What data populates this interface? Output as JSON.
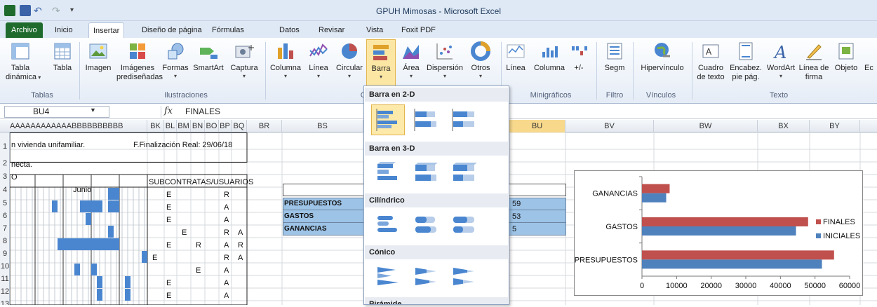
{
  "window": {
    "title": "GPUH Mimosas  -  Microsoft Excel"
  },
  "tabs": [
    "Archivo",
    "Inicio",
    "Insertar",
    "Diseño de página",
    "Fórmulas",
    "Datos",
    "Revisar",
    "Vista",
    "Foxit PDF"
  ],
  "ribbon": {
    "tabla_dinamica": [
      "Tabla",
      "dinámica"
    ],
    "tabla": "Tabla",
    "imagen": "Imagen",
    "imagenes_predis": [
      "Imágenes",
      "prediseñadas"
    ],
    "formas": "Formas",
    "smartart": "SmartArt",
    "captura": "Captura",
    "columna": "Columna",
    "linea": "Línea",
    "circular": "Circular",
    "barra": "Barra",
    "area": "Área",
    "dispersion": "Dispersión",
    "otros": "Otros",
    "mini_linea": "Línea",
    "mini_columna": "Columna",
    "mini_pm": "+/-",
    "segm": "Segm",
    "hipervinculo": "Hipervínculo",
    "cuadro_texto": [
      "Cuadro",
      "de texto"
    ],
    "encabez": [
      "Encabez.",
      "pie pág."
    ],
    "wordart": "WordArt",
    "linea_firma": [
      "Línea de",
      "firma"
    ],
    "objeto": "Objeto",
    "ec": "Ec",
    "groups": {
      "tablas": "Tablas",
      "ilustraciones": "Ilustraciones",
      "graficos": "G",
      "minigraficos": "Minigráficos",
      "filtro": "Filtro",
      "vinculos": "Vínculos",
      "texto": "Texto"
    }
  },
  "formula_bar": {
    "name_box": "BU4",
    "fx": "fx",
    "value": "FINALES"
  },
  "columns": [
    "AAAAAAAAAAAABBBBBBBBBB",
    "BK",
    "BL",
    "BM",
    "BN",
    "BO",
    "BP",
    "BQ",
    "BR",
    "BS",
    "BU",
    "BV",
    "BW",
    "BX",
    "BY"
  ],
  "rows": [
    "1",
    "2",
    "3",
    "4",
    "5",
    "6",
    "7",
    "8",
    "9",
    "10",
    "11",
    "12",
    "13"
  ],
  "cells": {
    "r1_text": "n vivienda unifamiliar.",
    "r1_fin": "F.Finalización Real: 29/06/18",
    "r2_text": "necta.",
    "r3_text": "O",
    "junio": "Junio",
    "subcontratas": "SUBCONTRATAS/USUARIOS",
    "presupuestos": "PRESUPUESTOS",
    "gastos": "GASTOS",
    "ganancias": "GANANCIAS",
    "bu5": "59",
    "bu6": "53",
    "bu7": "5",
    "marks": [
      {
        "row": 5,
        "col": 1,
        "t": "E"
      },
      {
        "row": 5,
        "col": 5,
        "t": "R"
      },
      {
        "row": 6,
        "col": 1,
        "t": "E"
      },
      {
        "row": 6,
        "col": 5,
        "t": "A"
      },
      {
        "row": 7,
        "col": 1,
        "t": "E"
      },
      {
        "row": 7,
        "col": 5,
        "t": "A"
      },
      {
        "row": 8,
        "col": 2,
        "t": "E"
      },
      {
        "row": 8,
        "col": 5,
        "t": "R"
      },
      {
        "row": 8,
        "col": 6,
        "t": "A"
      },
      {
        "row": 9,
        "col": 1,
        "t": "E"
      },
      {
        "row": 9,
        "col": 3,
        "t": "R"
      },
      {
        "row": 9,
        "col": 5,
        "t": "A"
      },
      {
        "row": 9,
        "col": 6,
        "t": "R"
      },
      {
        "row": 10,
        "col": 0,
        "t": "E"
      },
      {
        "row": 10,
        "col": 5,
        "t": "R"
      },
      {
        "row": 10,
        "col": 6,
        "t": "A"
      },
      {
        "row": 11,
        "col": 3,
        "t": "E"
      },
      {
        "row": 11,
        "col": 5,
        "t": "A"
      },
      {
        "row": 12,
        "col": 1,
        "t": "E"
      },
      {
        "row": 12,
        "col": 5,
        "t": "A"
      },
      {
        "row": 13,
        "col": 1,
        "t": "E"
      },
      {
        "row": 13,
        "col": 5,
        "t": "A"
      }
    ]
  },
  "gallery": {
    "sections": [
      "Barra en 2-D",
      "Barra en 3-D",
      "Cilíndrico",
      "Cónico",
      "Pirámide"
    ]
  },
  "colors": {
    "finales": "#c0504d",
    "iniciales": "#4f81bd",
    "gantt": "#4a86d0",
    "table_fill": "#9dc3e6"
  },
  "chart_data": {
    "type": "bar",
    "orientation": "horizontal",
    "categories": [
      "PRESUPUESTOS",
      "GASTOS",
      "GANANCIAS"
    ],
    "series": [
      {
        "name": "FINALES",
        "values": [
          55500,
          48000,
          8000
        ]
      },
      {
        "name": "INICIALES",
        "values": [
          52000,
          44500,
          7000
        ]
      }
    ],
    "xticks": [
      "0",
      "10000",
      "20000",
      "30000",
      "40000",
      "50000",
      "60000"
    ],
    "xlim": [
      0,
      60000
    ],
    "legend": "right"
  }
}
